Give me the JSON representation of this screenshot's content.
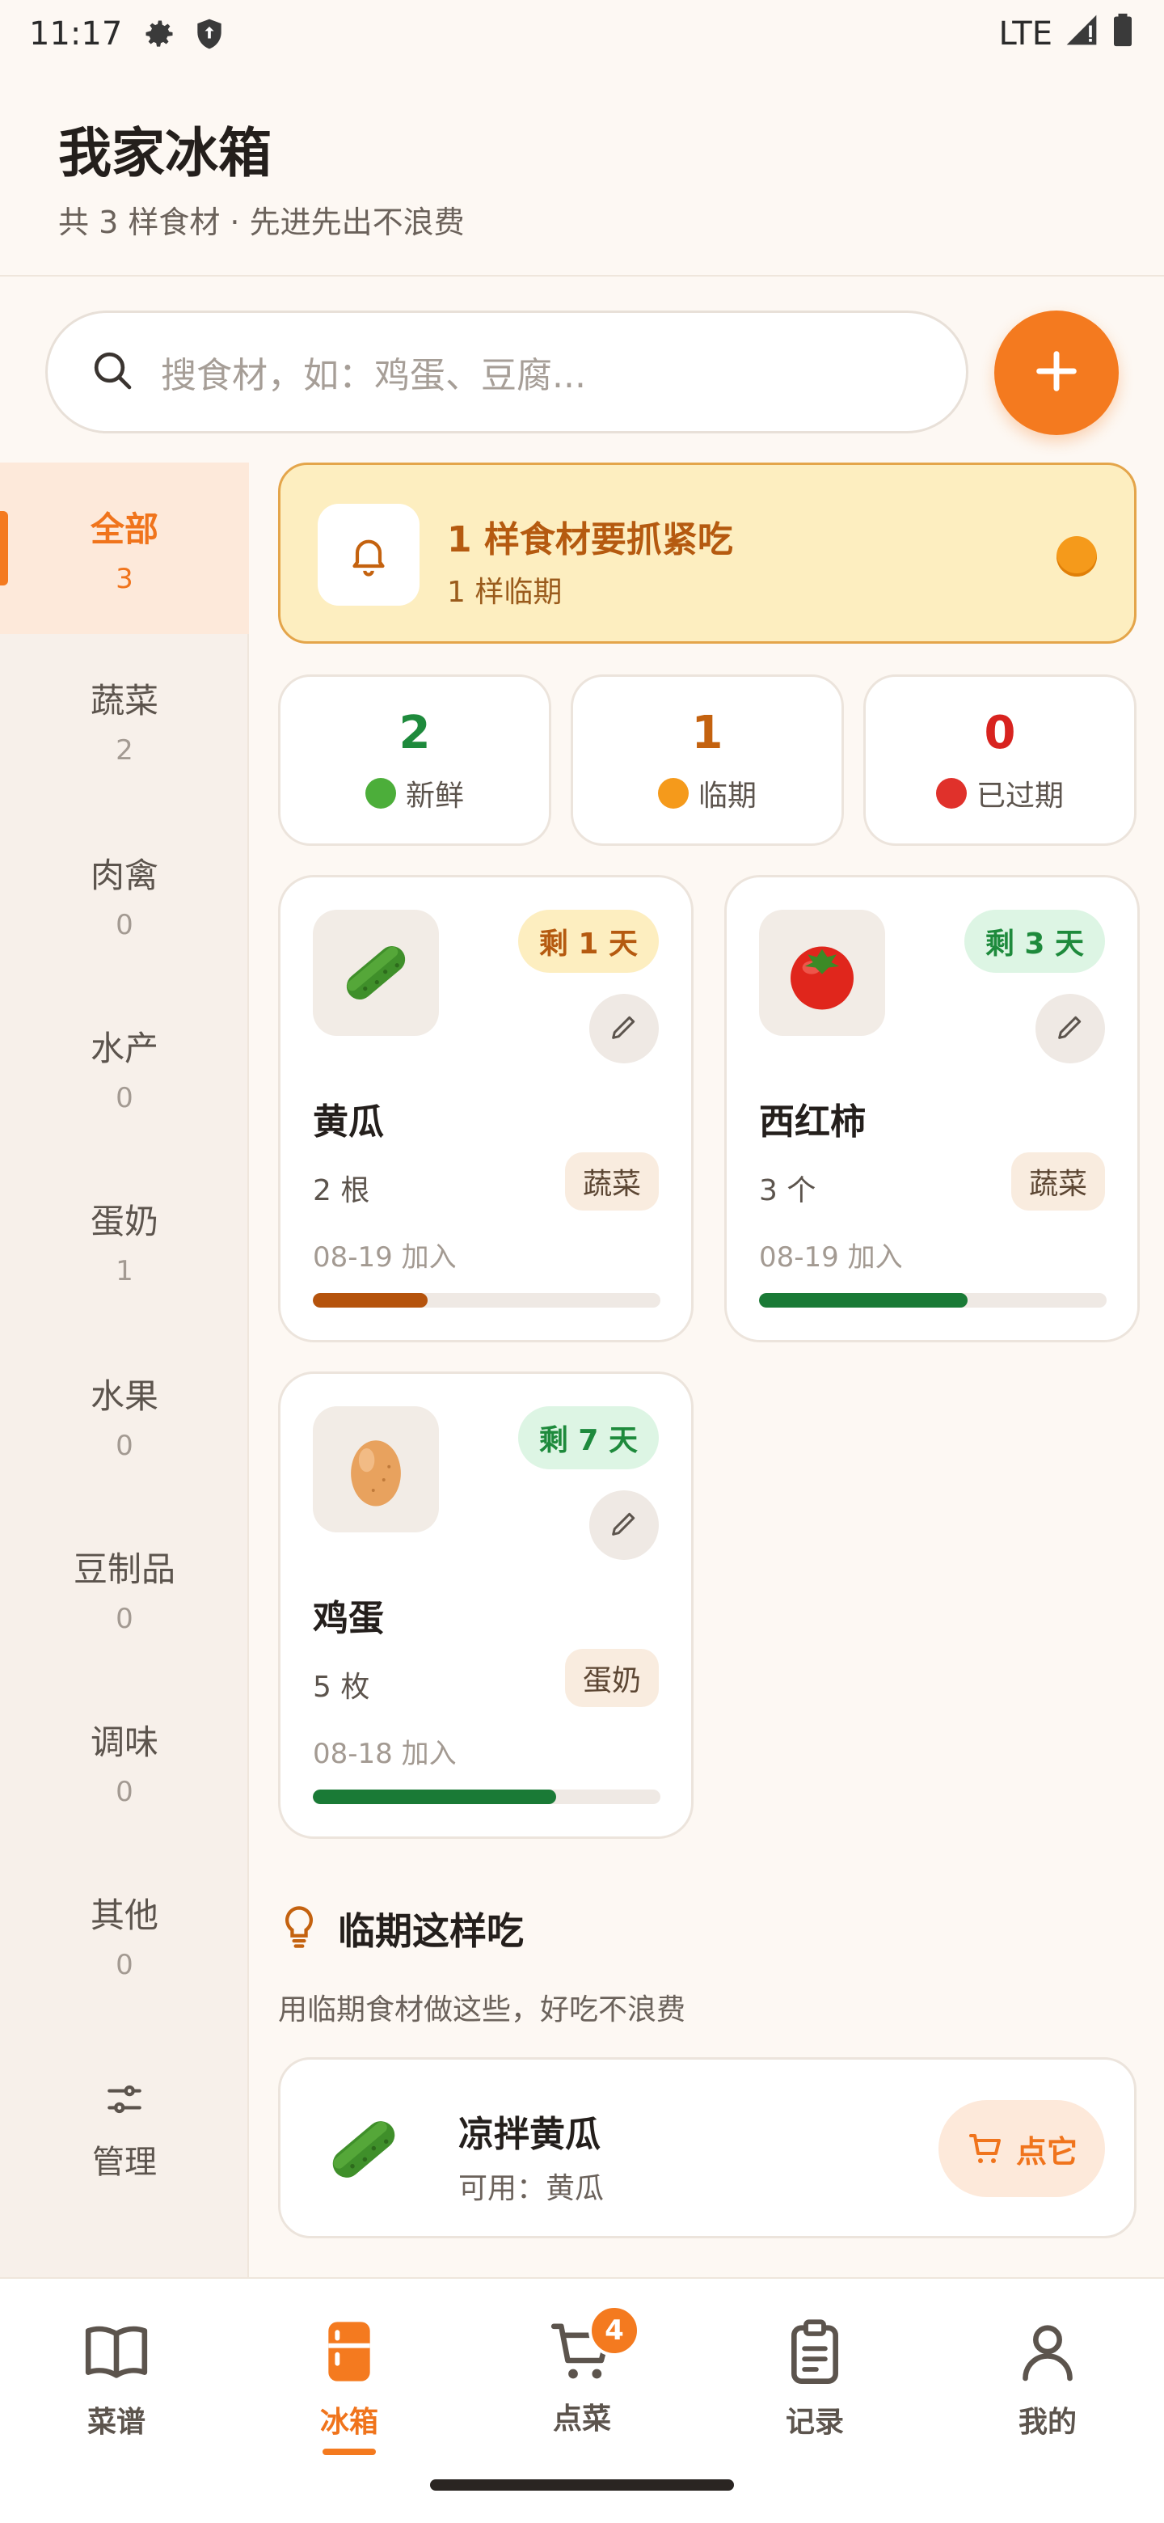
{
  "status_bar": {
    "time": "11:17",
    "network": "LTE"
  },
  "header": {
    "title": "我家冰箱",
    "subtitle": "共 3 样食材 · 先进先出不浪费"
  },
  "search": {
    "placeholder": "搜食材，如：鸡蛋、豆腐..."
  },
  "sidebar": {
    "categories": [
      {
        "name": "全部",
        "count": "3"
      },
      {
        "name": "蔬菜",
        "count": "2"
      },
      {
        "name": "肉禽",
        "count": "0"
      },
      {
        "name": "水产",
        "count": "0"
      },
      {
        "name": "蛋奶",
        "count": "1"
      },
      {
        "name": "水果",
        "count": "0"
      },
      {
        "name": "豆制品",
        "count": "0"
      },
      {
        "name": "调味",
        "count": "0"
      },
      {
        "name": "其他",
        "count": "0"
      }
    ],
    "manage_label": "管理"
  },
  "alert": {
    "title": "1 样食材要抓紧吃",
    "subtitle": "1 样临期"
  },
  "stats": [
    {
      "value": "2",
      "label": "新鲜",
      "color": "#1e8a3c"
    },
    {
      "value": "1",
      "label": "临期",
      "color": "#c4620f"
    },
    {
      "value": "0",
      "label": "已过期",
      "color": "#d8231f"
    }
  ],
  "foods": [
    {
      "emoji": "🥒",
      "name": "黄瓜",
      "quantity": "2 根",
      "category": "蔬菜",
      "added": "08-19 加入",
      "remaining": "剩 1 天",
      "status": "warning",
      "freshness": 0.33
    },
    {
      "emoji": "🍅",
      "name": "西红柿",
      "quantity": "3 个",
      "category": "蔬菜",
      "added": "08-19 加入",
      "remaining": "剩 3 天",
      "status": "fresh",
      "freshness": 0.6
    },
    {
      "emoji": "🥚",
      "name": "鸡蛋",
      "quantity": "5 枚",
      "category": "蛋奶",
      "added": "08-18 加入",
      "remaining": "剩 7 天",
      "status": "fresh",
      "freshness": 0.7
    }
  ],
  "suggestions": {
    "title": "临期这样吃",
    "subtitle": "用临期食材做这些，好吃不浪费",
    "recipe": {
      "emoji": "🥒",
      "name": "凉拌黄瓜",
      "uses": "可用：黄瓜",
      "order_label": "点它"
    }
  },
  "bottom_nav": [
    {
      "label": "菜谱",
      "icon": "book-icon"
    },
    {
      "label": "冰箱",
      "icon": "fridge-icon",
      "active": true
    },
    {
      "label": "点菜",
      "icon": "cart-icon",
      "badge": "4"
    },
    {
      "label": "记录",
      "icon": "clipboard-icon"
    },
    {
      "label": "我的",
      "icon": "person-icon"
    }
  ],
  "colors": {
    "accent": "#f47a1f",
    "warning_badge_bg": "#fdeec0",
    "warning_badge_text": "#b55a10",
    "fresh_badge_bg": "#ddf5e4",
    "fresh_badge_text": "#1e8a3c",
    "warning_bar": "#b5530c",
    "fresh_bar": "#1a7a36"
  }
}
